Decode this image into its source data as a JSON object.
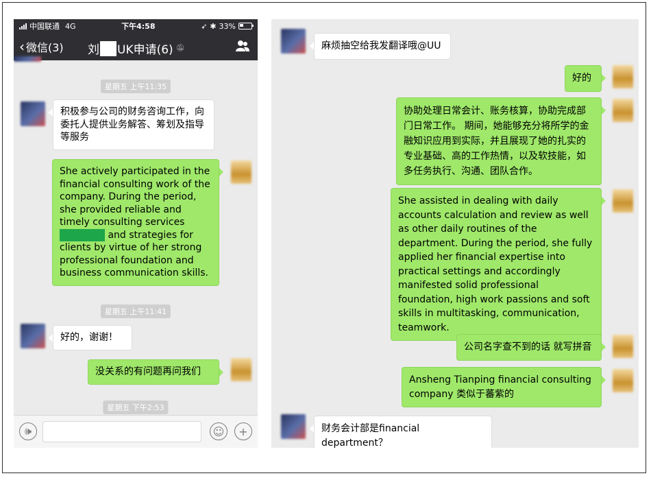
{
  "status_bar": {
    "carrier": "中国联通",
    "network": "4G",
    "time": "下午4:58",
    "battery": "33%"
  },
  "nav": {
    "back_label": "微信(3)",
    "title_prefix": "刘",
    "title_suffix": "UK申请(6)"
  },
  "left_chat": {
    "timestamps": [
      "星期五 上午11:35",
      "星期五 上午11:41",
      "星期五 下午2:53"
    ],
    "messages": [
      {
        "side": "left",
        "text": "积极参与公司的财务咨询工作，向委托人提供业务解答、筹划及指导等服务"
      },
      {
        "side": "right",
        "text_before": "She actively participated in the financial consulting work of the company. During the period, she provided reliable and timely consulting services",
        "text_after": "and strategies for clients by virtue of her strong professional foundation and business communication skills."
      },
      {
        "side": "left",
        "text": "好的，谢谢！"
      },
      {
        "side": "right",
        "text": "没关系的有问题再问我们"
      }
    ]
  },
  "right_chat": {
    "messages": [
      {
        "side": "left",
        "text": "麻烦抽空给我发翻译哦@UU"
      },
      {
        "side": "right",
        "text": "好的"
      },
      {
        "side": "right",
        "text": "协助处理日常会计、账务核算，协助完成部门日常工作。 期间，她能够充分将所学的金融知识应用到实际，并且展现了她的扎实的专业基础、高的工作热情，以及软技能，如多任务执行、沟通、团队合作。"
      },
      {
        "side": "right",
        "text": "She assisted in dealing with daily accounts calculation and review as well as other daily routines of the department. During the period, she fully applied her financial expertise into practical settings and accordingly manifested solid professional foundation, high work passions and soft skills in multitasking, communication, teamwork."
      },
      {
        "side": "right",
        "text": "公司名字查不到的话 就写拼音"
      },
      {
        "side": "right",
        "text": "Ansheng Tianping financial consulting company 类似于蕃紫的"
      },
      {
        "side": "left",
        "text": "财务会计部是financial department？"
      }
    ]
  },
  "icons": [
    "signal-icon",
    "bluetooth-icon",
    "location-arrow-icon",
    "battery-icon",
    "back-chevron-icon",
    "mute-icon",
    "contacts-icon",
    "voice-icon",
    "emoji-icon",
    "plus-icon"
  ],
  "colors": {
    "bar": "#2f2f33",
    "chat_bg": "#ebebeb",
    "green_bubble": "#9fe86a",
    "white_bubble": "#ffffff",
    "timestamp_bg": "#cfcfcf"
  }
}
